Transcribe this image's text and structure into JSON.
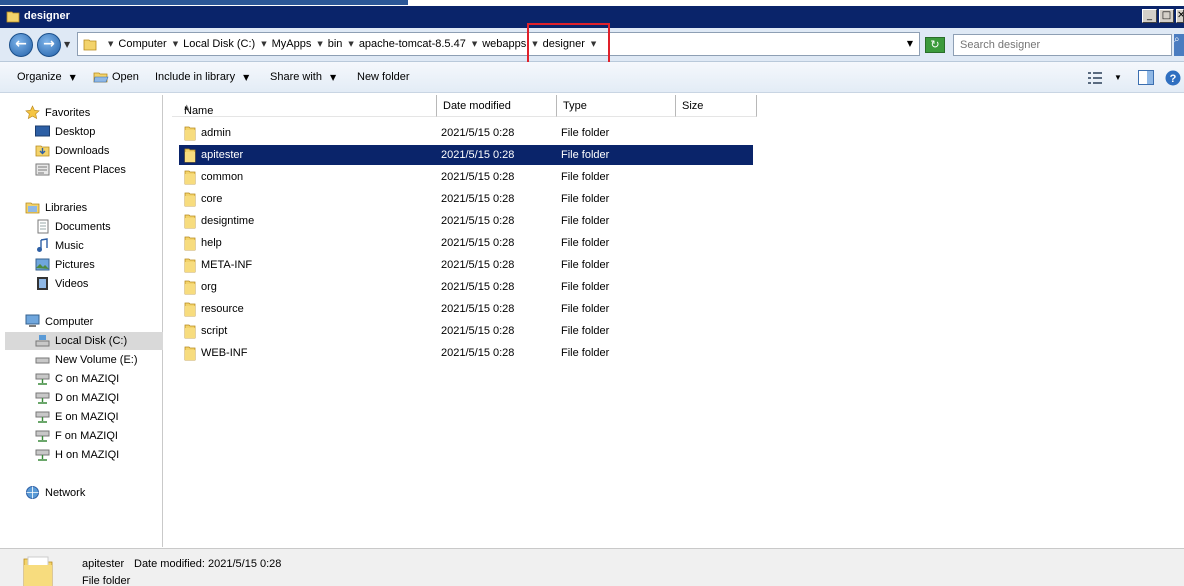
{
  "window": {
    "title": "designer"
  },
  "breadcrumb": [
    "Computer",
    "Local Disk (C:)",
    "MyApps",
    "bin",
    "apache-tomcat-8.5.47",
    "webapps",
    "designer"
  ],
  "search": {
    "placeholder": "Search designer"
  },
  "toolbar": {
    "organize": "Organize",
    "open": "Open",
    "include": "Include in library",
    "share": "Share with",
    "new_folder": "New folder"
  },
  "nav": {
    "favorites": "Favorites",
    "desktop": "Desktop",
    "downloads": "Downloads",
    "recent": "Recent Places",
    "libraries": "Libraries",
    "documents": "Documents",
    "music": "Music",
    "pictures": "Pictures",
    "videos": "Videos",
    "computer": "Computer",
    "drive_c": "Local Disk (C:)",
    "drive_e": "New Volume (E:)",
    "net_c": "C on MAZIQI",
    "net_d": "D on MAZIQI",
    "net_e": "E on MAZIQI",
    "net_f": "F on MAZIQI",
    "net_h": "H on MAZIQI",
    "network": "Network"
  },
  "columns": {
    "name": "Name",
    "date": "Date modified",
    "type": "Type",
    "size": "Size"
  },
  "files": [
    {
      "name": "admin",
      "date": "2021/5/15 0:28",
      "type": "File folder"
    },
    {
      "name": "apitester",
      "date": "2021/5/15 0:28",
      "type": "File folder"
    },
    {
      "name": "common",
      "date": "2021/5/15 0:28",
      "type": "File folder"
    },
    {
      "name": "core",
      "date": "2021/5/15 0:28",
      "type": "File folder"
    },
    {
      "name": "designtime",
      "date": "2021/5/15 0:28",
      "type": "File folder"
    },
    {
      "name": "help",
      "date": "2021/5/15 0:28",
      "type": "File folder"
    },
    {
      "name": "META-INF",
      "date": "2021/5/15 0:28",
      "type": "File folder"
    },
    {
      "name": "org",
      "date": "2021/5/15 0:28",
      "type": "File folder"
    },
    {
      "name": "resource",
      "date": "2021/5/15 0:28",
      "type": "File folder"
    },
    {
      "name": "script",
      "date": "2021/5/15 0:28",
      "type": "File folder"
    },
    {
      "name": "WEB-INF",
      "date": "2021/5/15 0:28",
      "type": "File folder"
    }
  ],
  "selected_index": 1,
  "details": {
    "name": "apitester",
    "date_label": "Date modified:",
    "date_value": "2021/5/15 0:28",
    "type": "File folder"
  },
  "colors": {
    "selection": "#0a246a",
    "titlebar": "#0a246a",
    "highlight_box": "#e0202a"
  },
  "icons": {
    "back": "back-arrow-icon",
    "forward": "forward-arrow-icon",
    "folder": "folder-icon",
    "refresh": "refresh-icon",
    "search": "search-icon",
    "views": "views-icon",
    "preview": "preview-pane-icon",
    "help": "help-icon"
  }
}
